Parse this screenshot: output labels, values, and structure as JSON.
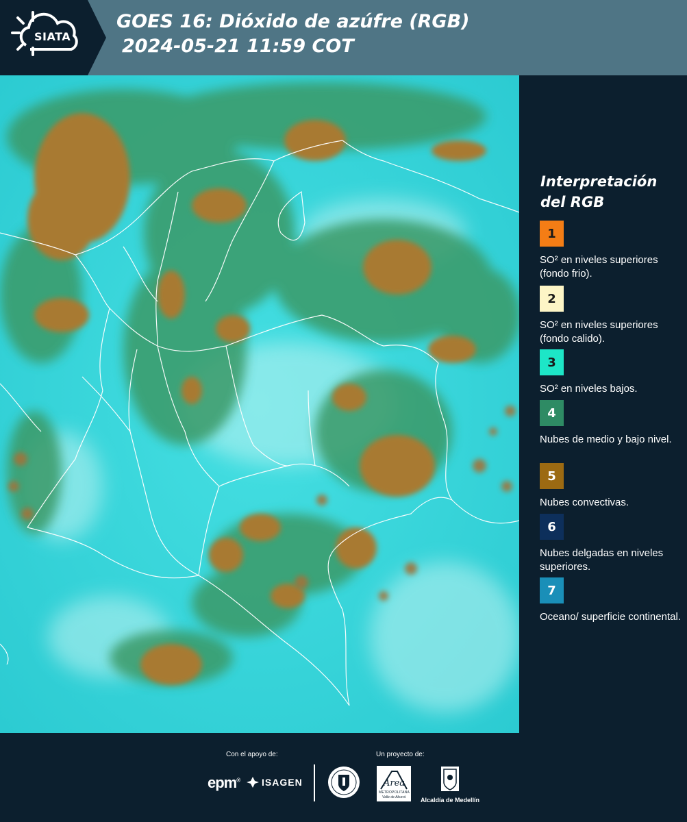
{
  "header": {
    "logo_text": "SIATA",
    "title_line1": "GOES 16: Dióxido de azúfre (RGB)",
    "title_line2": "2024-05-21 11:59 COT"
  },
  "map": {
    "colors": {
      "surface": "#33d6dc",
      "low_cloud": "#3f9a6a",
      "convective": "#a6792e",
      "borders": "#ffffff"
    }
  },
  "legend": {
    "title": "Interpretación del RGB",
    "items": [
      {
        "number": "1",
        "color": "#f47d15",
        "text": "SO² en niveles superiores (fondo frio)."
      },
      {
        "number": "2",
        "color": "#fdf5c6",
        "text": "SO² en niveles superiores (fondo calido)."
      },
      {
        "number": "3",
        "color": "#1de6c7",
        "text": "SO² en niveles bajos."
      },
      {
        "number": "4",
        "color": "#2e8b64",
        "text": "Nubes de medio y bajo nivel."
      },
      {
        "number": "5",
        "color": "#9c6a12",
        "text": "Nubes convectivas."
      },
      {
        "number": "6",
        "color": "#0d2f5b",
        "text": "Nubes delgadas en niveles superiores."
      },
      {
        "number": "7",
        "color": "#1a8fb8",
        "text": "Oceano/ superficie continental."
      }
    ]
  },
  "footer": {
    "support_label": "Con el apoyo de:",
    "project_label": "Un proyecto de:",
    "epm": "epm",
    "isagen": "ISAGEN",
    "area": "Área",
    "area_sub1": "METROPOLITANA",
    "area_sub2": "Valle de Aburrá",
    "alcaldia": "Alcaldía de Medellín"
  }
}
